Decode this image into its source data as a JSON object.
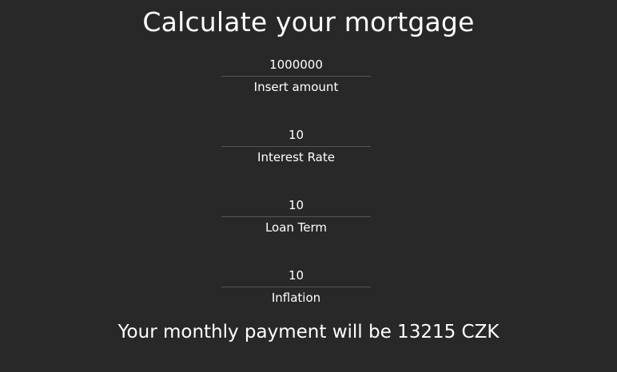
{
  "header": {
    "title": "Calculate your mortgage"
  },
  "form": {
    "fields": [
      {
        "value": "1000000",
        "label": "Insert amount"
      },
      {
        "value": "10",
        "label": "Interest Rate"
      },
      {
        "value": "10",
        "label": "Loan Term"
      },
      {
        "value": "10",
        "label": "Inflation"
      }
    ]
  },
  "result": {
    "text": "Your monthly payment will be 13215 CZK"
  },
  "colors": {
    "background": "#282828",
    "text": "#ffffff",
    "underline": "#555555"
  }
}
